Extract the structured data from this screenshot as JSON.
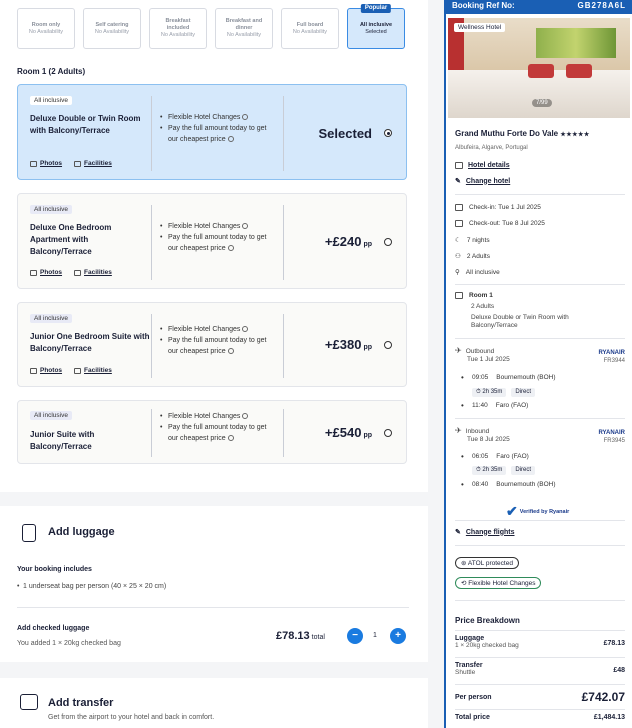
{
  "board_options": [
    {
      "title": "Room only",
      "sub": "No Availability"
    },
    {
      "title": "Self catering",
      "sub": "No Availability"
    },
    {
      "title": "Breakfast included",
      "sub": "No Availability"
    },
    {
      "title": "Breakfast and dinner",
      "sub": "No Availability"
    },
    {
      "title": "Full board",
      "sub": "No Availability"
    },
    {
      "title": "All inclusive",
      "sub": "Selected",
      "badge": "Popular"
    }
  ],
  "room_heading": "Room 1 (2 Adults)",
  "rooms": [
    {
      "tag": "All inclusive",
      "name": "Deluxe Double or Twin Room with Balcony/Terrace",
      "feat1": "Flexible Hotel Changes",
      "feat2": "Pay the full amount today to get our cheapest price",
      "price": "Selected",
      "pp": "",
      "photos": "Photos",
      "facilities": "Facilities"
    },
    {
      "tag": "All inclusive",
      "name": "Deluxe One Bedroom Apartment with Balcony/Terrace",
      "feat1": "Flexible Hotel Changes",
      "feat2": "Pay the full amount today to get our cheapest price",
      "price": "+£240",
      "pp": "pp",
      "photos": "Photos",
      "facilities": "Facilities"
    },
    {
      "tag": "All inclusive",
      "name": "Junior One Bedroom Suite with Balcony/Terrace",
      "feat1": "Flexible Hotel Changes",
      "feat2": "Pay the full amount today to get our cheapest price",
      "price": "+£380",
      "pp": "pp",
      "photos": "Photos",
      "facilities": "Facilities"
    },
    {
      "tag": "All inclusive",
      "name": "Junior Suite with Balcony/Terrace",
      "feat1": "Flexible Hotel Changes",
      "feat2": "Pay the full amount today to get our cheapest price",
      "price": "+£540",
      "pp": "pp"
    }
  ],
  "luggage": {
    "title": "Add luggage",
    "included_heading": "Your booking includes",
    "included_item": "1 underseat bag per person (40 × 25 × 20 cm)",
    "add_heading": "Add checked luggage",
    "add_sub": "You added 1 × 20kg checked bag",
    "price": "£78.13",
    "price_suffix": "total",
    "minus": "−",
    "plus": "+",
    "qty": "1"
  },
  "transfer": {
    "title": "Add transfer",
    "sub": "Get from the airport to your hotel and back in comfort."
  },
  "summary": {
    "ref_label": "Booking Ref No:",
    "ref_value": "GB278A6L",
    "image_label": "Wellness Hotel",
    "image_count": "7/99",
    "hotel_name": "Grand Muthu Forte Do Vale",
    "stars": "★★★★★",
    "location": "Albufeira, Algarve, Portugal",
    "hotel_details": "Hotel details",
    "change_hotel": "Change hotel",
    "checkin": "Check-in: Tue 1 Jul 2025",
    "checkout": "Check-out: Tue 8 Jul 2025",
    "nights": "7 nights",
    "adults": "2 Adults",
    "board": "All inclusive",
    "room_title": "Room 1",
    "room_adults": "2 Adults",
    "room_name": "Deluxe Double or Twin Room with Balcony/Terrace",
    "outbound": {
      "label": "Outbound",
      "date": "Tue 1 Jul 2025",
      "airline": "RYANAIR",
      "flight": "FR3944",
      "dep_time": "09:05",
      "dep_place": "Bournemouth (BOH)",
      "duration": "2h 35m",
      "type": "Direct",
      "arr_time": "11:40",
      "arr_place": "Faro (FAO)"
    },
    "inbound": {
      "label": "Inbound",
      "date": "Tue 8 Jul 2025",
      "airline": "RYANAIR",
      "flight": "FR3945",
      "dep_time": "06:05",
      "dep_place": "Faro (FAO)",
      "duration": "2h 35m",
      "type": "Direct",
      "arr_time": "08:40",
      "arr_place": "Bournemouth (BOH)"
    },
    "verified": "Verified by Ryanair",
    "change_flights": "Change flights",
    "atol": "ATOL protected",
    "flex": "Flexible Hotel Changes",
    "price_title": "Price Breakdown",
    "luggage_label": "Luggage",
    "luggage_sub": "1 × 20kg checked bag",
    "luggage_price": "£78.13",
    "transfer_label": "Transfer",
    "transfer_sub": "Shuttle",
    "transfer_price": "£48",
    "pp_label": "Per person",
    "pp_price": "£742.07",
    "total_label": "Total price",
    "total_price": "£1,484.13"
  },
  "colors": {
    "accent": "#1a7be0",
    "brand": "#1a5fb4",
    "selected_bg": "#d5e8fb"
  }
}
